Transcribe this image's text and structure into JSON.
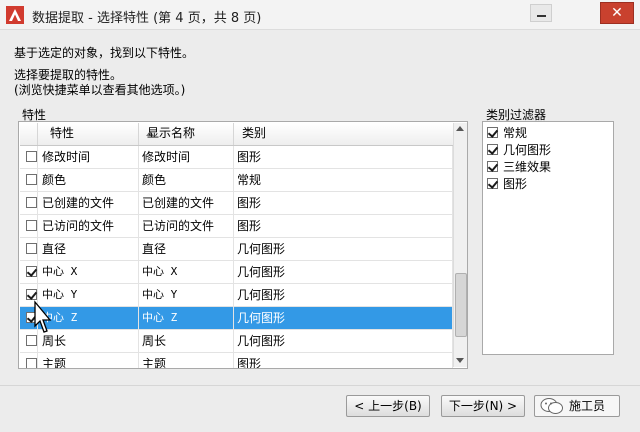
{
  "window": {
    "title": "数据提取 - 选择特性 (第 4 页，共 8 页)",
    "close_glyph": "✕"
  },
  "instructions": {
    "line1": "基于选定的对象，找到以下特性。",
    "line2": "选择要提取的特性。",
    "line3": "(浏览快捷菜单以查看其他选项。)"
  },
  "properties_group": {
    "label": "特性",
    "columns": [
      "特性",
      "显示名称",
      "类别"
    ],
    "rows": [
      {
        "checked": false,
        "property": "修改时间",
        "display_name": "修改时间",
        "category": "图形",
        "selected": false
      },
      {
        "checked": false,
        "property": "颜色",
        "display_name": "颜色",
        "category": "常规",
        "selected": false
      },
      {
        "checked": false,
        "property": "已创建的文件",
        "display_name": "已创建的文件",
        "category": "图形",
        "selected": false
      },
      {
        "checked": false,
        "property": "已访问的文件",
        "display_name": "已访问的文件",
        "category": "图形",
        "selected": false
      },
      {
        "checked": false,
        "property": "直径",
        "display_name": "直径",
        "category": "几何图形",
        "selected": false
      },
      {
        "checked": true,
        "property": "中心 X",
        "display_name": "中心 X",
        "category": "几何图形",
        "selected": false
      },
      {
        "checked": true,
        "property": "中心 Y",
        "display_name": "中心 Y",
        "category": "几何图形",
        "selected": false
      },
      {
        "checked": true,
        "property": "中心 Z",
        "display_name": "中心 Z",
        "category": "几何图形",
        "selected": true
      },
      {
        "checked": false,
        "property": "周长",
        "display_name": "周长",
        "category": "几何图形",
        "selected": false
      },
      {
        "checked": false,
        "property": "主题",
        "display_name": "主题",
        "category": "图形",
        "selected": false
      }
    ]
  },
  "category_filter": {
    "label": "类别过滤器",
    "items": [
      {
        "label": "常规",
        "checked": true
      },
      {
        "label": "几何图形",
        "checked": true
      },
      {
        "label": "三维效果",
        "checked": true
      },
      {
        "label": "图形",
        "checked": true
      }
    ]
  },
  "buttons": {
    "prev": "< 上一步(B)",
    "next": "下一步(N) >",
    "cancel": "施工员"
  },
  "colors": {
    "selection": "#3399e6",
    "close_button": "#c9412e"
  }
}
